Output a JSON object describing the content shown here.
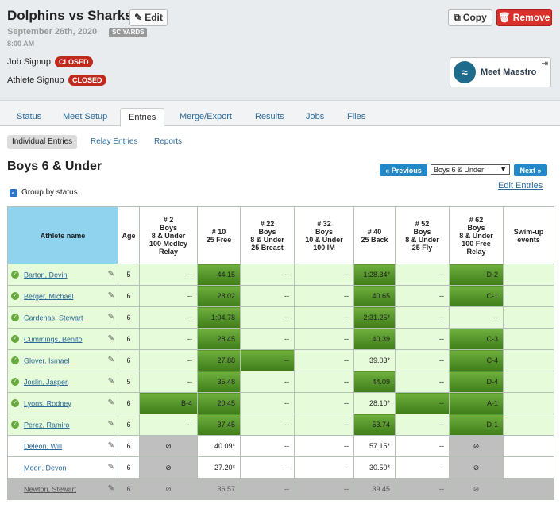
{
  "meet": {
    "title": "Dolphins vs Sharks",
    "edit_label": "Edit",
    "copy_label": "Copy",
    "remove_label": "Remove",
    "date": "September 26th, 2020",
    "course": "SC YARDS",
    "time": "8:00 AM",
    "job_signup_label": "Job Signup",
    "job_signup_status": "CLOSED",
    "athlete_signup_label": "Athlete Signup",
    "athlete_signup_status": "CLOSED",
    "maestro_label": "Meet Maestro"
  },
  "tabs": [
    "Status",
    "Meet Setup",
    "Entries",
    "Merge/Export",
    "Results",
    "Jobs",
    "Files"
  ],
  "active_tab": "Entries",
  "subtabs": [
    "Individual Entries",
    "Relay Entries",
    "Reports"
  ],
  "event": {
    "title": "Boys 6 & Under",
    "prev_label": "« Previous",
    "next_label": "Next »",
    "select_value": "Boys 6 & Under",
    "edit_entries_label": "Edit Entries",
    "group_by_status_label": "Group by status"
  },
  "table": {
    "headers": [
      "Athlete name",
      "Age",
      "# 2\nBoys\n8 & Under\n100 Medley\nRelay",
      "# 10\n25 Free",
      "# 22\nBoys\n8 & Under\n25 Breast",
      "# 32\nBoys\n10 & Under\n100 IM",
      "# 40\n25 Back",
      "# 52\nBoys\n8 & Under\n25 Fly",
      "# 62\nBoys\n8 & Under\n100 Free\nRelay",
      "Swim-up\nevents"
    ],
    "rows": [
      {
        "name": "Barton, Devin",
        "age": "5",
        "entered": true,
        "cells": [
          "--",
          "44.15",
          "--",
          "--",
          "1:28.34*",
          "--",
          "D-2",
          ""
        ]
      },
      {
        "name": "Berger, Michael",
        "age": "6",
        "entered": true,
        "cells": [
          "--",
          "28.02",
          "--",
          "--",
          "40.65",
          "--",
          "C-1",
          ""
        ]
      },
      {
        "name": "Cardenas, Stewart",
        "age": "6",
        "entered": true,
        "cells": [
          "--",
          "1:04.78",
          "--",
          "--",
          "2:31.25*",
          "--",
          "--",
          ""
        ]
      },
      {
        "name": "Cummings, Benito",
        "age": "6",
        "entered": true,
        "cells": [
          "--",
          "28.45",
          "--",
          "--",
          "40.39",
          "--",
          "C-3",
          ""
        ]
      },
      {
        "name": "Glover, Ismael",
        "age": "6",
        "entered": true,
        "cells": [
          "--",
          "27.88",
          "--",
          "--",
          "39.03*",
          "--",
          "C-4",
          ""
        ]
      },
      {
        "name": "Joslin, Jasper",
        "age": "5",
        "entered": true,
        "cells": [
          "--",
          "35.48",
          "--",
          "--",
          "44.09",
          "--",
          "D-4",
          ""
        ]
      },
      {
        "name": "Lyons, Rodney",
        "age": "6",
        "entered": true,
        "cells": [
          "B-4",
          "20.45",
          "--",
          "--",
          "28.10*",
          "--",
          "A-1",
          ""
        ]
      },
      {
        "name": "Perez, Ramiro",
        "age": "6",
        "entered": true,
        "cells": [
          "--",
          "37.45",
          "--",
          "--",
          "53.74",
          "--",
          "D-1",
          ""
        ]
      },
      {
        "name": "Deleon, Will",
        "age": "6",
        "entered": false,
        "cells": [
          "⊘",
          "40.09*",
          "--",
          "--",
          "57.15*",
          "--",
          "⊘",
          ""
        ]
      },
      {
        "name": "Moon, Devon",
        "age": "6",
        "entered": false,
        "cells": [
          "⊘",
          "27.20*",
          "--",
          "--",
          "30.50*",
          "--",
          "⊘",
          ""
        ]
      },
      {
        "name": "Newton, Stewart",
        "age": "6",
        "entered": false,
        "cells": [
          "⊘",
          "36.57",
          "--",
          "--",
          "39.45",
          "--",
          "⊘",
          ""
        ]
      }
    ]
  }
}
